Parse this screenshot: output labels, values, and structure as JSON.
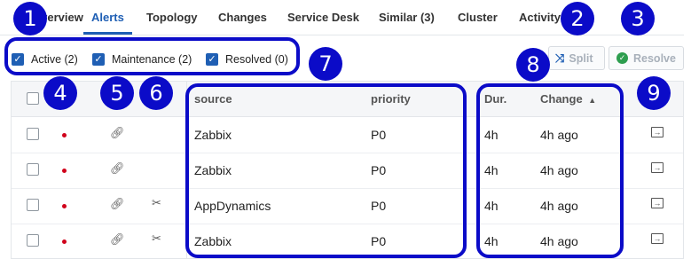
{
  "tabs": [
    {
      "label": "Overview"
    },
    {
      "label": "Alerts"
    },
    {
      "label": "Topology"
    },
    {
      "label": "Changes"
    },
    {
      "label": "Service Desk"
    },
    {
      "label": "Similar (3)"
    },
    {
      "label": "Cluster"
    },
    {
      "label": "Activity"
    }
  ],
  "active_tab": "Alerts",
  "filters": [
    {
      "label": "Active (2)",
      "checked": true
    },
    {
      "label": "Maintenance (2)",
      "checked": true
    },
    {
      "label": "Resolved (0)",
      "checked": true
    }
  ],
  "buttons": {
    "split": "Split",
    "resolve": "Resolve"
  },
  "table": {
    "headers": {
      "source": "source",
      "priority": "priority",
      "duration": "Dur.",
      "change": "Change"
    },
    "rows": [
      {
        "source": "Zabbix",
        "priority": "P0",
        "duration": "4h",
        "change": "4h ago",
        "maintenance": false
      },
      {
        "source": "Zabbix",
        "priority": "P0",
        "duration": "4h",
        "change": "4h ago",
        "maintenance": false
      },
      {
        "source": "AppDynamics",
        "priority": "P0",
        "duration": "4h",
        "change": "4h ago",
        "maintenance": true
      },
      {
        "source": "Zabbix",
        "priority": "P0",
        "duration": "4h",
        "change": "4h ago",
        "maintenance": true
      }
    ]
  },
  "annotations": [
    "1",
    "2",
    "3",
    "4",
    "5",
    "6",
    "7",
    "8",
    "9"
  ],
  "colors": {
    "accent": "#1f5fb4",
    "annotation": "#0b0bc8",
    "status_dot": "#d0021b",
    "resolve_icon": "#2e9e4f"
  },
  "icons": {
    "sort": "sort-asc-icon",
    "split": "split-icon",
    "resolve": "check-circle-icon",
    "link": "link-icon",
    "maintenance": "wrench-icon",
    "action": "open-incident-icon"
  }
}
